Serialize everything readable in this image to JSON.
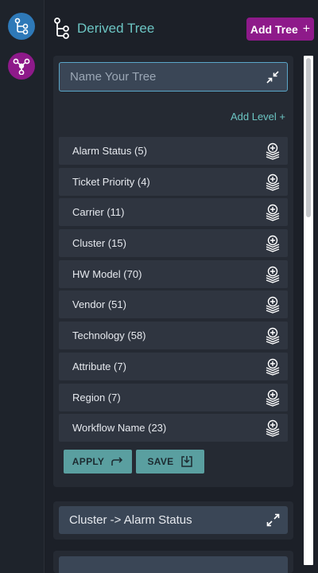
{
  "header": {
    "title": "Derived Tree",
    "add_tree_label": "Add Tree",
    "add_tree_icon": "plus"
  },
  "rail": {
    "items": [
      {
        "icon": "tree-icon",
        "color": "#2e79b8"
      },
      {
        "icon": "graph-icon",
        "color": "#8e1a8a"
      }
    ]
  },
  "editor": {
    "name_placeholder": "Name Your Tree",
    "name_value": "",
    "add_level_label": "Add Level +",
    "levels": [
      {
        "label": "Alarm Status (5)"
      },
      {
        "label": "Ticket Priority (4)"
      },
      {
        "label": "Carrier (11)"
      },
      {
        "label": "Cluster (15)"
      },
      {
        "label": "HW Model (70)"
      },
      {
        "label": "Vendor (51)"
      },
      {
        "label": "Technology (58)"
      },
      {
        "label": "Attribute (7)"
      },
      {
        "label": "Region (7)"
      },
      {
        "label": "Workflow Name (23)"
      }
    ],
    "apply_label": "APPLY",
    "save_label": "SAVE"
  },
  "saved_trees": [
    {
      "label": "Cluster -> Alarm Status"
    }
  ],
  "colors": {
    "accent_teal": "#6cc5c3",
    "accent_purple": "#8e1a8a",
    "button_teal": "#5a9fa0",
    "rail_blue": "#2e79b8"
  }
}
